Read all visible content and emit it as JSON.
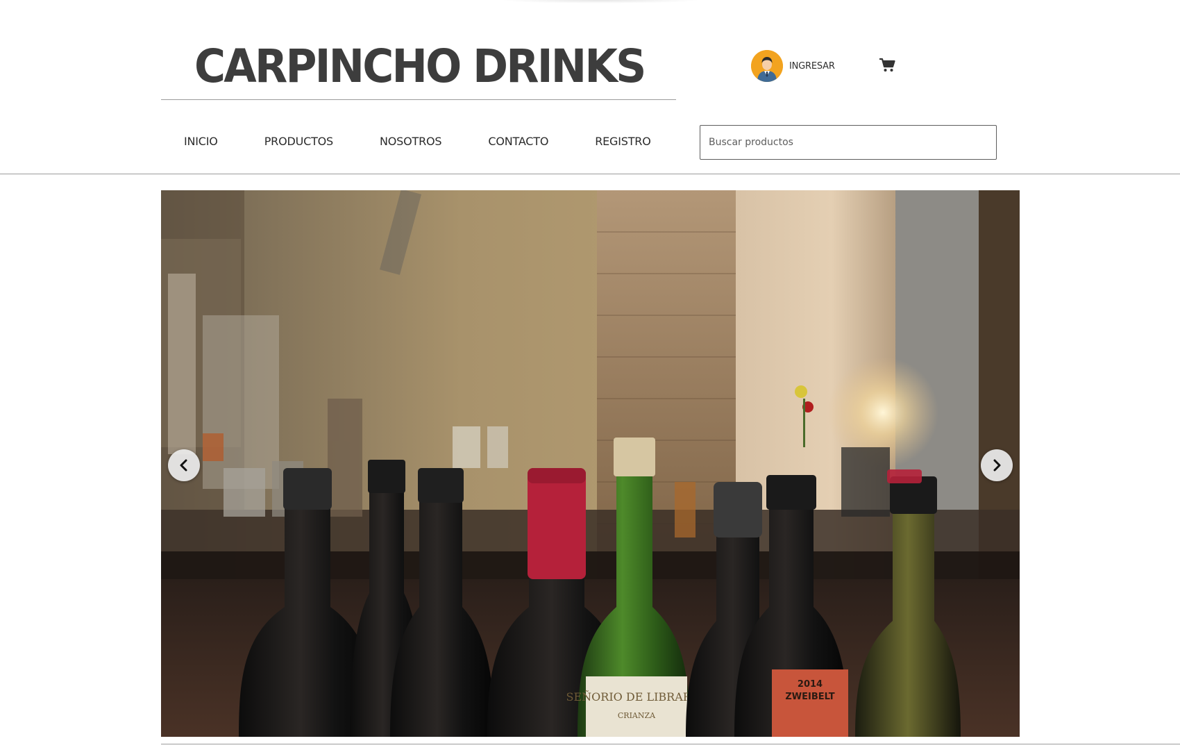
{
  "header": {
    "brand_title": "CARPINCHO DRINKS",
    "login_label": "INGRESAR",
    "avatar_icon": "user-avatar-icon",
    "cart_icon": "shopping-cart-icon"
  },
  "nav": {
    "items": [
      {
        "label": "INICIO"
      },
      {
        "label": "PRODUCTOS"
      },
      {
        "label": "NOSOTROS"
      },
      {
        "label": "CONTACTO"
      },
      {
        "label": "REGISTRO"
      }
    ]
  },
  "search": {
    "placeholder": "Buscar productos",
    "value": ""
  },
  "carousel": {
    "prev_icon": "chevron-left-icon",
    "next_icon": "chevron-right-icon",
    "bottle_labels": {
      "green_bottle": "SEÑORIO DE LIBRARES",
      "green_bottle_sub": "CRIANZA",
      "red_label_year": "2014",
      "red_label_name": "ZWEIBELT"
    }
  },
  "colors": {
    "brand_text": "#3d3d3d",
    "avatar_bg": "#f2a31f",
    "rule": "#9b9b9b"
  }
}
